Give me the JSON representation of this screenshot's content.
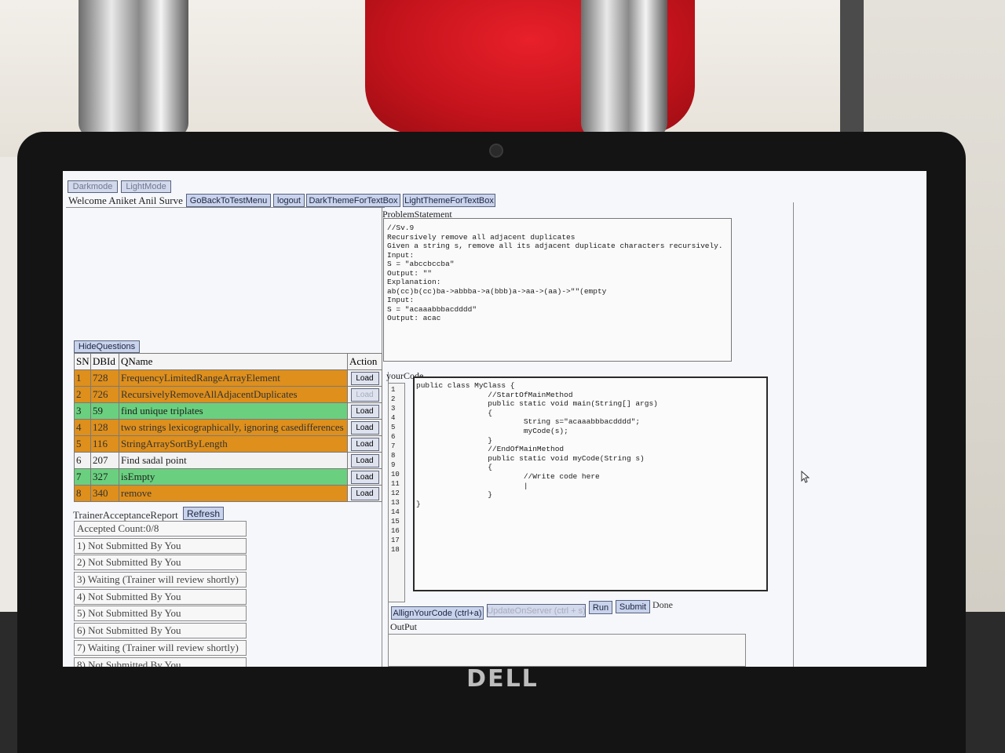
{
  "header": {
    "darkmode": "Darkmode",
    "lightmode": "LightMode",
    "welcome": "Welcome Aniket Anil Surve",
    "go_back": "GoBackToTestMenu",
    "logout": "logout",
    "dark_theme": "DarkThemeForTextBox",
    "light_theme": "LightThemeForTextBox"
  },
  "questions": {
    "toggle_label": "HideQuestions",
    "columns": [
      "SN",
      "DBId",
      "QName",
      "Action"
    ],
    "rows": [
      {
        "sn": "1",
        "dbid": "728",
        "name": "FrequencyLimitedRangeArrayElement",
        "color": "orange",
        "action": "Load"
      },
      {
        "sn": "2",
        "dbid": "726",
        "name": "RecursivelyRemoveAllAdjacentDuplicates",
        "color": "orange",
        "action": "Load"
      },
      {
        "sn": "3",
        "dbid": "59",
        "name": "find unique triplates",
        "color": "green",
        "action": "Load"
      },
      {
        "sn": "4",
        "dbid": "128",
        "name": "two strings lexicographically, ignoring casedifferences",
        "color": "orange",
        "action": "Load"
      },
      {
        "sn": "5",
        "dbid": "116",
        "name": "StringArraySortByLength",
        "color": "orange",
        "action": "Load"
      },
      {
        "sn": "6",
        "dbid": "207",
        "name": "Find sadal point",
        "color": "white",
        "action": "Load"
      },
      {
        "sn": "7",
        "dbid": "327",
        "name": "isEmpty",
        "color": "green",
        "action": "Load"
      },
      {
        "sn": "8",
        "dbid": "340",
        "name": "remove",
        "color": "orange",
        "action": "Load"
      }
    ]
  },
  "report": {
    "title": "TrainerAcceptanceReport",
    "refresh": "Refresh",
    "accepted": "Accepted Count:0/8",
    "items": [
      "1) Not Submitted By You",
      "2) Not Submitted By You",
      "3) Waiting (Trainer will review shortly)",
      "4) Not Submitted By You",
      "5) Not Submitted By You",
      "6) Not Submitted By You",
      "7) Waiting (Trainer will review shortly)",
      "8) Not Submitted By You"
    ]
  },
  "problem": {
    "label": "ProblemStatement",
    "lines": [
      "//Sv.9",
      "Recursively remove all adjacent duplicates",
      "Given a string s, remove all its adjacent duplicate characters recursively.",
      "",
      "Input:",
      "S = \"abccbccba\"",
      "Output: \"\"",
      "Explanation:",
      "ab(cc)b(cc)ba->abbba->a(bbb)a->aa->(aa)->\"\"(empty",
      "",
      "Input:",
      "S = \"acaaabbbacdddd\"",
      "Output: acac"
    ]
  },
  "code": {
    "label": "yourCode",
    "line_numbers": [
      "1",
      "2",
      "3",
      "4",
      "5",
      "6",
      "7",
      "8",
      "9",
      "10",
      "11",
      "12",
      "13",
      "14",
      "15",
      "16",
      "17",
      "18"
    ],
    "lines": [
      "public class MyClass {",
      "",
      "                //StartOfMainMethod",
      "                public static void main(String[] args)",
      "                {",
      "                        String s=\"acaaabbbacdddd\";",
      "                        myCode(s);",
      "                }",
      "                //EndOfMainMethod",
      "",
      "",
      "                public static void myCode(String s)",
      "                {",
      "                        //Write code here",
      "                        |",
      "                }",
      "}",
      ""
    ]
  },
  "actions": {
    "align": "AllignYourCode (ctrl+a)",
    "update": "UpdateOnServer (ctrl + s)",
    "run": "Run",
    "submit": "Submit",
    "status": "Done",
    "output_label": "OutPut"
  },
  "brand": "DELL"
}
